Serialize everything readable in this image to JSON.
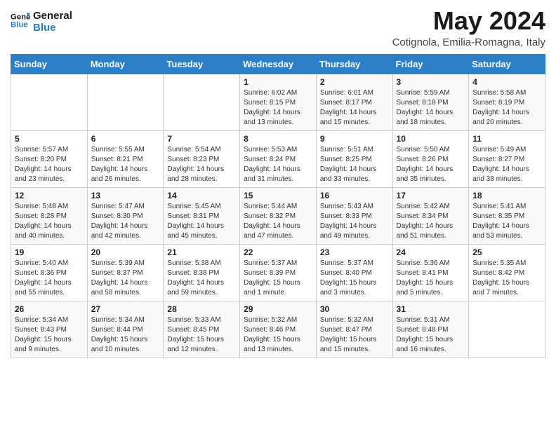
{
  "logo": {
    "line1": "General",
    "line2": "Blue"
  },
  "title": "May 2024",
  "location": "Cotignola, Emilia-Romagna, Italy",
  "headers": [
    "Sunday",
    "Monday",
    "Tuesday",
    "Wednesday",
    "Thursday",
    "Friday",
    "Saturday"
  ],
  "weeks": [
    [
      {
        "day": "",
        "info": ""
      },
      {
        "day": "",
        "info": ""
      },
      {
        "day": "",
        "info": ""
      },
      {
        "day": "1",
        "info": "Sunrise: 6:02 AM\nSunset: 8:15 PM\nDaylight: 14 hours\nand 13 minutes."
      },
      {
        "day": "2",
        "info": "Sunrise: 6:01 AM\nSunset: 8:17 PM\nDaylight: 14 hours\nand 15 minutes."
      },
      {
        "day": "3",
        "info": "Sunrise: 5:59 AM\nSunset: 8:18 PM\nDaylight: 14 hours\nand 18 minutes."
      },
      {
        "day": "4",
        "info": "Sunrise: 5:58 AM\nSunset: 8:19 PM\nDaylight: 14 hours\nand 20 minutes."
      }
    ],
    [
      {
        "day": "5",
        "info": "Sunrise: 5:57 AM\nSunset: 8:20 PM\nDaylight: 14 hours\nand 23 minutes."
      },
      {
        "day": "6",
        "info": "Sunrise: 5:55 AM\nSunset: 8:21 PM\nDaylight: 14 hours\nand 26 minutes."
      },
      {
        "day": "7",
        "info": "Sunrise: 5:54 AM\nSunset: 8:23 PM\nDaylight: 14 hours\nand 28 minutes."
      },
      {
        "day": "8",
        "info": "Sunrise: 5:53 AM\nSunset: 8:24 PM\nDaylight: 14 hours\nand 31 minutes."
      },
      {
        "day": "9",
        "info": "Sunrise: 5:51 AM\nSunset: 8:25 PM\nDaylight: 14 hours\nand 33 minutes."
      },
      {
        "day": "10",
        "info": "Sunrise: 5:50 AM\nSunset: 8:26 PM\nDaylight: 14 hours\nand 35 minutes."
      },
      {
        "day": "11",
        "info": "Sunrise: 5:49 AM\nSunset: 8:27 PM\nDaylight: 14 hours\nand 38 minutes."
      }
    ],
    [
      {
        "day": "12",
        "info": "Sunrise: 5:48 AM\nSunset: 8:28 PM\nDaylight: 14 hours\nand 40 minutes."
      },
      {
        "day": "13",
        "info": "Sunrise: 5:47 AM\nSunset: 8:30 PM\nDaylight: 14 hours\nand 42 minutes."
      },
      {
        "day": "14",
        "info": "Sunrise: 5:45 AM\nSunset: 8:31 PM\nDaylight: 14 hours\nand 45 minutes."
      },
      {
        "day": "15",
        "info": "Sunrise: 5:44 AM\nSunset: 8:32 PM\nDaylight: 14 hours\nand 47 minutes."
      },
      {
        "day": "16",
        "info": "Sunrise: 5:43 AM\nSunset: 8:33 PM\nDaylight: 14 hours\nand 49 minutes."
      },
      {
        "day": "17",
        "info": "Sunrise: 5:42 AM\nSunset: 8:34 PM\nDaylight: 14 hours\nand 51 minutes."
      },
      {
        "day": "18",
        "info": "Sunrise: 5:41 AM\nSunset: 8:35 PM\nDaylight: 14 hours\nand 53 minutes."
      }
    ],
    [
      {
        "day": "19",
        "info": "Sunrise: 5:40 AM\nSunset: 8:36 PM\nDaylight: 14 hours\nand 55 minutes."
      },
      {
        "day": "20",
        "info": "Sunrise: 5:39 AM\nSunset: 8:37 PM\nDaylight: 14 hours\nand 58 minutes."
      },
      {
        "day": "21",
        "info": "Sunrise: 5:38 AM\nSunset: 8:38 PM\nDaylight: 14 hours\nand 59 minutes."
      },
      {
        "day": "22",
        "info": "Sunrise: 5:37 AM\nSunset: 8:39 PM\nDaylight: 15 hours\nand 1 minute."
      },
      {
        "day": "23",
        "info": "Sunrise: 5:37 AM\nSunset: 8:40 PM\nDaylight: 15 hours\nand 3 minutes."
      },
      {
        "day": "24",
        "info": "Sunrise: 5:36 AM\nSunset: 8:41 PM\nDaylight: 15 hours\nand 5 minutes."
      },
      {
        "day": "25",
        "info": "Sunrise: 5:35 AM\nSunset: 8:42 PM\nDaylight: 15 hours\nand 7 minutes."
      }
    ],
    [
      {
        "day": "26",
        "info": "Sunrise: 5:34 AM\nSunset: 8:43 PM\nDaylight: 15 hours\nand 9 minutes."
      },
      {
        "day": "27",
        "info": "Sunrise: 5:34 AM\nSunset: 8:44 PM\nDaylight: 15 hours\nand 10 minutes."
      },
      {
        "day": "28",
        "info": "Sunrise: 5:33 AM\nSunset: 8:45 PM\nDaylight: 15 hours\nand 12 minutes."
      },
      {
        "day": "29",
        "info": "Sunrise: 5:32 AM\nSunset: 8:46 PM\nDaylight: 15 hours\nand 13 minutes."
      },
      {
        "day": "30",
        "info": "Sunrise: 5:32 AM\nSunset: 8:47 PM\nDaylight: 15 hours\nand 15 minutes."
      },
      {
        "day": "31",
        "info": "Sunrise: 5:31 AM\nSunset: 8:48 PM\nDaylight: 15 hours\nand 16 minutes."
      },
      {
        "day": "",
        "info": ""
      }
    ]
  ]
}
